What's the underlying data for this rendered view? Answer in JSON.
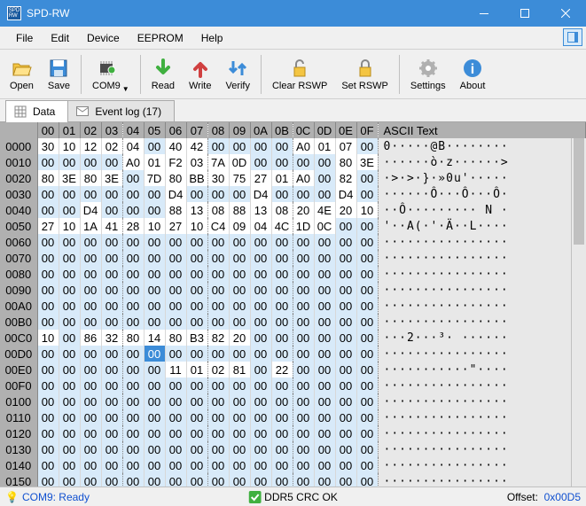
{
  "title": "SPD-RW",
  "menu": [
    "File",
    "Edit",
    "Device",
    "EEPROM",
    "Help"
  ],
  "toolbar": {
    "open": "Open",
    "save": "Save",
    "com": "COM9",
    "read": "Read",
    "write": "Write",
    "verify": "Verify",
    "clear": "Clear RSWP",
    "set": "Set RSWP",
    "settings": "Settings",
    "about": "About"
  },
  "tabs": {
    "data": "Data",
    "events": "Event log (17)"
  },
  "hdr_ascii": "ASCII Text",
  "rows": [
    {
      "a": "0000",
      "b": [
        "30",
        "10",
        "12",
        "02",
        "04",
        "00",
        "40",
        "42",
        "00",
        "00",
        "00",
        "00",
        "A0",
        "01",
        "07",
        "00"
      ],
      "d": [
        1,
        1,
        1,
        1,
        1,
        0,
        1,
        1,
        0,
        0,
        0,
        0,
        1,
        1,
        1,
        0
      ],
      "t": "0·····@B········"
    },
    {
      "a": "0010",
      "b": [
        "00",
        "00",
        "00",
        "00",
        "A0",
        "01",
        "F2",
        "03",
        "7A",
        "0D",
        "00",
        "00",
        "00",
        "00",
        "80",
        "3E"
      ],
      "d": [
        0,
        0,
        0,
        0,
        1,
        1,
        1,
        1,
        1,
        1,
        0,
        0,
        0,
        0,
        1,
        1
      ],
      "t": "······ò·z······>"
    },
    {
      "a": "0020",
      "b": [
        "80",
        "3E",
        "80",
        "3E",
        "00",
        "7D",
        "80",
        "BB",
        "30",
        "75",
        "27",
        "01",
        "A0",
        "00",
        "82",
        "00"
      ],
      "d": [
        1,
        1,
        1,
        1,
        0,
        1,
        1,
        1,
        1,
        1,
        1,
        1,
        1,
        0,
        1,
        0
      ],
      "t": "·>·>·}·»0u'·····"
    },
    {
      "a": "0030",
      "b": [
        "00",
        "00",
        "00",
        "00",
        "00",
        "00",
        "D4",
        "00",
        "00",
        "00",
        "D4",
        "00",
        "00",
        "00",
        "D4",
        "00"
      ],
      "d": [
        0,
        0,
        0,
        0,
        0,
        0,
        1,
        0,
        0,
        0,
        1,
        0,
        0,
        0,
        1,
        0
      ],
      "t": "······Ô···Ô···Ô·"
    },
    {
      "a": "0040",
      "b": [
        "00",
        "00",
        "D4",
        "00",
        "00",
        "00",
        "88",
        "13",
        "08",
        "88",
        "13",
        "08",
        "20",
        "4E",
        "20",
        "10"
      ],
      "d": [
        0,
        0,
        1,
        0,
        0,
        0,
        1,
        1,
        1,
        1,
        1,
        1,
        1,
        1,
        1,
        1
      ],
      "t": "··Ô········· N ·"
    },
    {
      "a": "0050",
      "b": [
        "27",
        "10",
        "1A",
        "41",
        "28",
        "10",
        "27",
        "10",
        "C4",
        "09",
        "04",
        "4C",
        "1D",
        "0C",
        "00",
        "00"
      ],
      "d": [
        1,
        1,
        1,
        1,
        1,
        1,
        1,
        1,
        1,
        1,
        1,
        1,
        1,
        1,
        0,
        0
      ],
      "t": "'··A(·'·Ä··L····"
    },
    {
      "a": "0060",
      "b": [
        "00",
        "00",
        "00",
        "00",
        "00",
        "00",
        "00",
        "00",
        "00",
        "00",
        "00",
        "00",
        "00",
        "00",
        "00",
        "00"
      ],
      "d": [
        0,
        0,
        0,
        0,
        0,
        0,
        0,
        0,
        0,
        0,
        0,
        0,
        0,
        0,
        0,
        0
      ],
      "t": "················"
    },
    {
      "a": "0070",
      "b": [
        "00",
        "00",
        "00",
        "00",
        "00",
        "00",
        "00",
        "00",
        "00",
        "00",
        "00",
        "00",
        "00",
        "00",
        "00",
        "00"
      ],
      "d": [
        0,
        0,
        0,
        0,
        0,
        0,
        0,
        0,
        0,
        0,
        0,
        0,
        0,
        0,
        0,
        0
      ],
      "t": "················"
    },
    {
      "a": "0080",
      "b": [
        "00",
        "00",
        "00",
        "00",
        "00",
        "00",
        "00",
        "00",
        "00",
        "00",
        "00",
        "00",
        "00",
        "00",
        "00",
        "00"
      ],
      "d": [
        0,
        0,
        0,
        0,
        0,
        0,
        0,
        0,
        0,
        0,
        0,
        0,
        0,
        0,
        0,
        0
      ],
      "t": "················"
    },
    {
      "a": "0090",
      "b": [
        "00",
        "00",
        "00",
        "00",
        "00",
        "00",
        "00",
        "00",
        "00",
        "00",
        "00",
        "00",
        "00",
        "00",
        "00",
        "00"
      ],
      "d": [
        0,
        0,
        0,
        0,
        0,
        0,
        0,
        0,
        0,
        0,
        0,
        0,
        0,
        0,
        0,
        0
      ],
      "t": "················"
    },
    {
      "a": "00A0",
      "b": [
        "00",
        "00",
        "00",
        "00",
        "00",
        "00",
        "00",
        "00",
        "00",
        "00",
        "00",
        "00",
        "00",
        "00",
        "00",
        "00"
      ],
      "d": [
        0,
        0,
        0,
        0,
        0,
        0,
        0,
        0,
        0,
        0,
        0,
        0,
        0,
        0,
        0,
        0
      ],
      "t": "················"
    },
    {
      "a": "00B0",
      "b": [
        "00",
        "00",
        "00",
        "00",
        "00",
        "00",
        "00",
        "00",
        "00",
        "00",
        "00",
        "00",
        "00",
        "00",
        "00",
        "00"
      ],
      "d": [
        0,
        0,
        0,
        0,
        0,
        0,
        0,
        0,
        0,
        0,
        0,
        0,
        0,
        0,
        0,
        0
      ],
      "t": "················"
    },
    {
      "a": "00C0",
      "b": [
        "10",
        "00",
        "86",
        "32",
        "80",
        "14",
        "80",
        "B3",
        "82",
        "20",
        "00",
        "00",
        "00",
        "00",
        "00",
        "00"
      ],
      "d": [
        1,
        0,
        1,
        1,
        1,
        1,
        1,
        1,
        1,
        1,
        0,
        0,
        0,
        0,
        0,
        0
      ],
      "t": "···2···³· ······"
    },
    {
      "a": "00D0",
      "b": [
        "00",
        "00",
        "00",
        "00",
        "00",
        "00",
        "00",
        "00",
        "00",
        "00",
        "00",
        "00",
        "00",
        "00",
        "00",
        "00"
      ],
      "d": [
        0,
        0,
        0,
        0,
        0,
        0,
        0,
        0,
        0,
        0,
        0,
        0,
        0,
        0,
        0,
        0
      ],
      "t": "················",
      "sel": 5
    },
    {
      "a": "00E0",
      "b": [
        "00",
        "00",
        "00",
        "00",
        "00",
        "00",
        "11",
        "01",
        "02",
        "81",
        "00",
        "22",
        "00",
        "00",
        "00",
        "00"
      ],
      "d": [
        0,
        0,
        0,
        0,
        0,
        0,
        1,
        1,
        1,
        1,
        0,
        1,
        0,
        0,
        0,
        0
      ],
      "t": "···········\"····"
    },
    {
      "a": "00F0",
      "b": [
        "00",
        "00",
        "00",
        "00",
        "00",
        "00",
        "00",
        "00",
        "00",
        "00",
        "00",
        "00",
        "00",
        "00",
        "00",
        "00"
      ],
      "d": [
        0,
        0,
        0,
        0,
        0,
        0,
        0,
        0,
        0,
        0,
        0,
        0,
        0,
        0,
        0,
        0
      ],
      "t": "················"
    },
    {
      "a": "0100",
      "b": [
        "00",
        "00",
        "00",
        "00",
        "00",
        "00",
        "00",
        "00",
        "00",
        "00",
        "00",
        "00",
        "00",
        "00",
        "00",
        "00"
      ],
      "d": [
        0,
        0,
        0,
        0,
        0,
        0,
        0,
        0,
        0,
        0,
        0,
        0,
        0,
        0,
        0,
        0
      ],
      "t": "················"
    },
    {
      "a": "0110",
      "b": [
        "00",
        "00",
        "00",
        "00",
        "00",
        "00",
        "00",
        "00",
        "00",
        "00",
        "00",
        "00",
        "00",
        "00",
        "00",
        "00"
      ],
      "d": [
        0,
        0,
        0,
        0,
        0,
        0,
        0,
        0,
        0,
        0,
        0,
        0,
        0,
        0,
        0,
        0
      ],
      "t": "················"
    },
    {
      "a": "0120",
      "b": [
        "00",
        "00",
        "00",
        "00",
        "00",
        "00",
        "00",
        "00",
        "00",
        "00",
        "00",
        "00",
        "00",
        "00",
        "00",
        "00"
      ],
      "d": [
        0,
        0,
        0,
        0,
        0,
        0,
        0,
        0,
        0,
        0,
        0,
        0,
        0,
        0,
        0,
        0
      ],
      "t": "················"
    },
    {
      "a": "0130",
      "b": [
        "00",
        "00",
        "00",
        "00",
        "00",
        "00",
        "00",
        "00",
        "00",
        "00",
        "00",
        "00",
        "00",
        "00",
        "00",
        "00"
      ],
      "d": [
        0,
        0,
        0,
        0,
        0,
        0,
        0,
        0,
        0,
        0,
        0,
        0,
        0,
        0,
        0,
        0
      ],
      "t": "················"
    },
    {
      "a": "0140",
      "b": [
        "00",
        "00",
        "00",
        "00",
        "00",
        "00",
        "00",
        "00",
        "00",
        "00",
        "00",
        "00",
        "00",
        "00",
        "00",
        "00"
      ],
      "d": [
        0,
        0,
        0,
        0,
        0,
        0,
        0,
        0,
        0,
        0,
        0,
        0,
        0,
        0,
        0,
        0
      ],
      "t": "················"
    },
    {
      "a": "0150",
      "b": [
        "00",
        "00",
        "00",
        "00",
        "00",
        "00",
        "00",
        "00",
        "00",
        "00",
        "00",
        "00",
        "00",
        "00",
        "00",
        "00"
      ],
      "d": [
        0,
        0,
        0,
        0,
        0,
        0,
        0,
        0,
        0,
        0,
        0,
        0,
        0,
        0,
        0,
        0
      ],
      "t": "················"
    }
  ],
  "status": {
    "port": "COM9: Ready",
    "crc": "DDR5 CRC OK",
    "off_lbl": "Offset:",
    "off_val": "0x00D5"
  }
}
